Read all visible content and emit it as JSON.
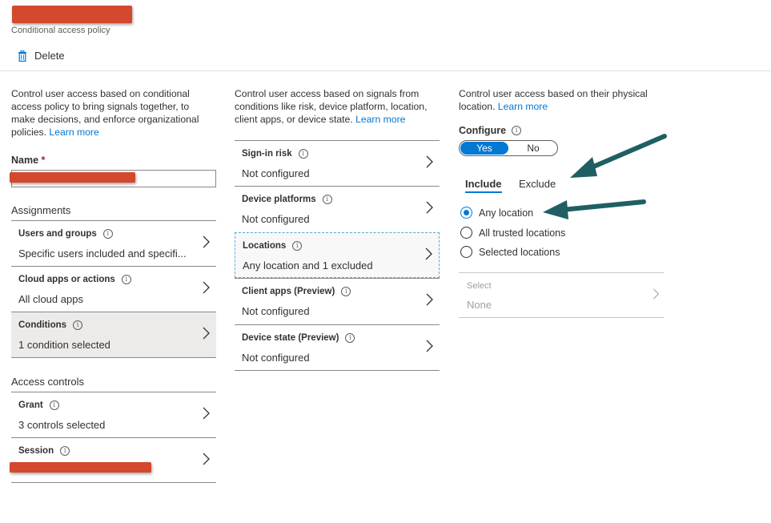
{
  "header": {
    "subtitle": "Conditional access policy",
    "delete_label": "Delete"
  },
  "left": {
    "description": "Control user access based on conditional access policy to bring signals together, to make decisions, and enforce organizational policies.",
    "learn_more": "Learn more",
    "name_label": "Name",
    "required_mark": "*",
    "assignments_heading": "Assignments",
    "assignments": [
      {
        "title": "Users and groups",
        "value": "Specific users included and specifi..."
      },
      {
        "title": "Cloud apps or actions",
        "value": "All cloud apps"
      },
      {
        "title": "Conditions",
        "value": "1 condition selected"
      }
    ],
    "access_controls_heading": "Access controls",
    "access_controls": [
      {
        "title": "Grant",
        "value": "3 controls selected"
      },
      {
        "title": "Session",
        "value": ""
      }
    ]
  },
  "middle": {
    "description": "Control user access based on signals from conditions like risk, device platform, location, client apps, or device state.",
    "learn_more": "Learn more",
    "conditions": [
      {
        "title": "Sign-in risk",
        "value": "Not configured"
      },
      {
        "title": "Device platforms",
        "value": "Not configured"
      },
      {
        "title": "Locations",
        "value": "Any location and 1 excluded"
      },
      {
        "title": "Client apps (Preview)",
        "value": "Not configured"
      },
      {
        "title": "Device state (Preview)",
        "value": "Not configured"
      }
    ]
  },
  "right": {
    "description": "Control user access based on their physical location.",
    "learn_more": "Learn more",
    "configure_label": "Configure",
    "toggle_yes": "Yes",
    "toggle_no": "No",
    "tabs": [
      "Include",
      "Exclude"
    ],
    "options": [
      "Any location",
      "All trusted locations",
      "Selected locations"
    ],
    "selected_option": "Any location",
    "select_label": "Select",
    "select_value": "None"
  },
  "colors": {
    "accent": "#0078d4",
    "redaction": "#d4482e",
    "arrow": "#1f5f63"
  }
}
